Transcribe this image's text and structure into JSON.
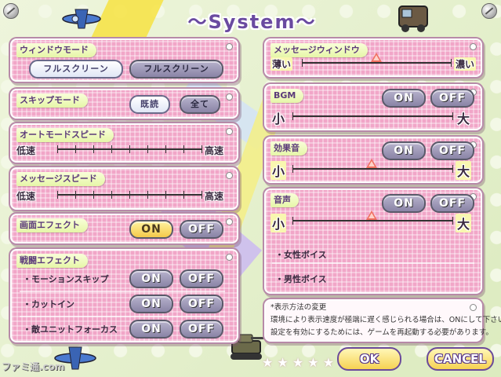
{
  "title": "〜System〜",
  "window_mode": {
    "label": "ウィンドウモード",
    "option_a": "フルスクリーン",
    "option_b": "フルスクリーン"
  },
  "skip_mode": {
    "label": "スキップモード",
    "option_a": "既読",
    "option_b": "全て"
  },
  "auto_speed": {
    "label": "オートモードスピード",
    "min": "低速",
    "max": "高速"
  },
  "message_speed": {
    "label": "メッセージスピード",
    "min": "低速",
    "max": "高速"
  },
  "screen_effect": {
    "label": "画面エフェクト",
    "on": "ON",
    "off": "OFF"
  },
  "battle_effect": {
    "label": "戦闘エフェクト",
    "rows": [
      {
        "label": "・モーションスキップ",
        "on": "ON",
        "off": "OFF"
      },
      {
        "label": "・カットイン",
        "on": "ON",
        "off": "OFF"
      },
      {
        "label": "・敵ユニットフォーカス",
        "on": "ON",
        "off": "OFF"
      }
    ]
  },
  "message_window": {
    "label": "メッセージウィンドウ",
    "min": "薄い",
    "max": "濃い",
    "level": 0.5
  },
  "bgm": {
    "label": "BGM",
    "on": "ON",
    "off": "OFF",
    "min": "小",
    "max": "大"
  },
  "se": {
    "label": "効果音",
    "on": "ON",
    "off": "OFF",
    "min": "小",
    "max": "大",
    "level": 0.5
  },
  "voice": {
    "label": "音声",
    "on": "ON",
    "off": "OFF",
    "min": "小",
    "max": "大",
    "level": 0.5,
    "female": "・女性ボイス",
    "male": "・男性ボイス"
  },
  "note": {
    "heading": "*表示方法の変更",
    "line1": "環境により表示速度が極端に遅く感じられる場合は、ONにして下さい。",
    "line2": "設定を有効にするためには、ゲームを再起動する必要があります。"
  },
  "ok_label": "OK",
  "cancel_label": "CANCEL",
  "watermark": "ファミ通.com",
  "colors": {
    "panel": "#f1a6c8",
    "label_bg": "#e6f6a8",
    "on_active": "#f5c94a",
    "inactive": "#8a84a6",
    "title": "#6a4aa0"
  }
}
